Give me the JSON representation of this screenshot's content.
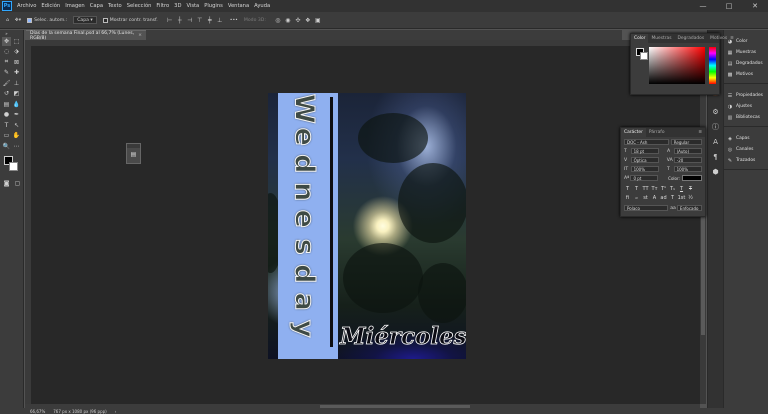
{
  "app": {
    "logo": "Ps",
    "menu": [
      "Archivo",
      "Edición",
      "Imagen",
      "Capa",
      "Texto",
      "Selección",
      "Filtro",
      "3D",
      "Vista",
      "Plugins",
      "Ventana",
      "Ayuda"
    ],
    "window_controls": [
      "—",
      "□",
      "✕"
    ]
  },
  "options_bar": {
    "auto_select_label": "Selec. autom.:",
    "layer_dropdown": "Capa",
    "transform_controls_label": "Mostrar contr. transf.",
    "mode_3d_label": "Modo 3D:"
  },
  "document": {
    "tab_title": "Días de la semana Final.psd al 66,7% (Lunes, RGB/8)",
    "close_glyph": "×",
    "vertical_word_letters": [
      "W",
      "e",
      "d",
      "n",
      "e",
      "s",
      "d",
      "a",
      "y"
    ],
    "script_word": "Miércoles"
  },
  "status_bar": {
    "zoom": "66,67%",
    "dimensions": "767 px x 1080 px (96 ppp)"
  },
  "color_panel": {
    "tabs": [
      "Color",
      "Muestras",
      "Degradados",
      "Motivos"
    ],
    "active_tab": "Color"
  },
  "character_panel": {
    "tabs": [
      "Carácter",
      "Párrafo"
    ],
    "font_family": "DOC - Ash",
    "font_style": "Regular",
    "font_size": "18 pt",
    "leading": "(Auto)",
    "kerning": "Óptica",
    "tracking": "-20",
    "vertical_scale": "100%",
    "horizontal_scale": "100%",
    "baseline_shift": "0 pt",
    "color_label": "Color:",
    "language": "Polaco",
    "antialias": "Enfocado",
    "format_buttons": [
      "T",
      "T",
      "TT",
      "Tт",
      "T¹",
      "T₁",
      "T",
      "T"
    ],
    "opentype_buttons": [
      "fi",
      "ℴ",
      "st",
      "A",
      "ad",
      "T",
      "1st",
      "½"
    ]
  },
  "right_panels": {
    "group1": [
      "Color",
      "Muestras",
      "Degradados",
      "Motivos"
    ],
    "group2": [
      "Propiedades",
      "Ajustes",
      "Bibliotecas"
    ],
    "group3": [
      "Capas",
      "Canales",
      "Trazados"
    ]
  },
  "colors": {
    "accent": "#31a8ff",
    "strip_blue": "#8fb0f0",
    "chrome_dark": "#323232",
    "chrome_mid": "#3c3c3c",
    "canvas_bg": "#282828"
  }
}
